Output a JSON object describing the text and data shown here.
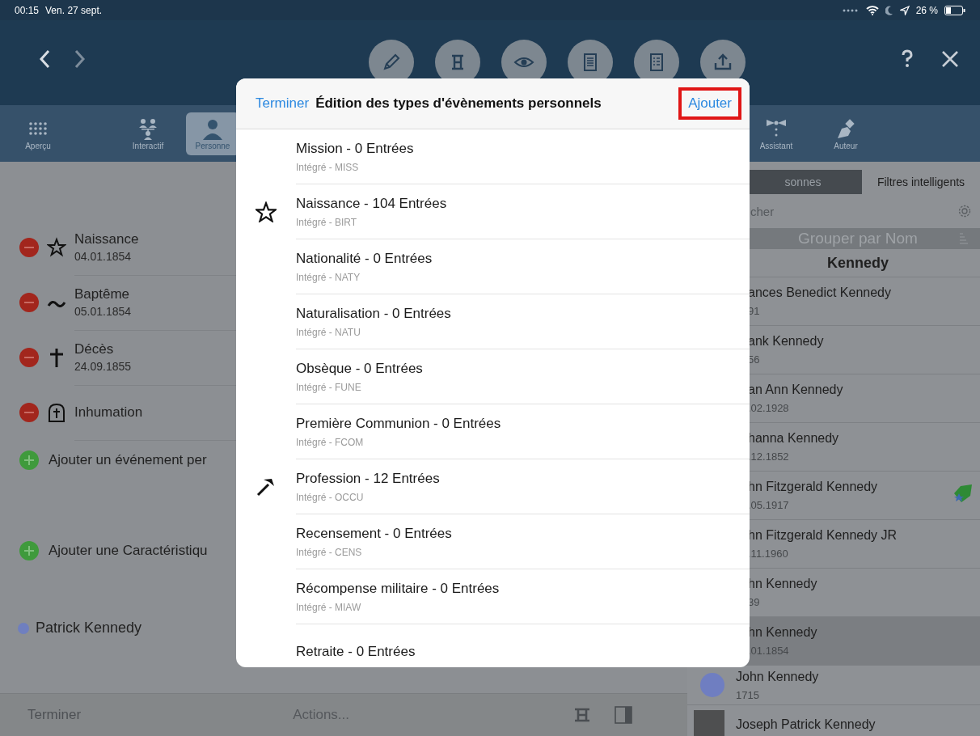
{
  "status_bar": {
    "time": "00:15",
    "date": "Ven. 27 sept.",
    "battery": "26 %"
  },
  "tab_bar": {
    "left": [
      {
        "label": "Aperçu",
        "selected": false
      },
      {
        "label": "Interactif",
        "selected": false
      },
      {
        "label": "Personne",
        "selected": true
      }
    ],
    "right": [
      {
        "label": "Assistant",
        "selected": false
      },
      {
        "label": "Auteur",
        "selected": false
      }
    ]
  },
  "events": [
    {
      "kind": "star",
      "title": "Naissance",
      "date": "04.01.1854"
    },
    {
      "kind": "tilde",
      "title": "Baptême",
      "date": "05.01.1854"
    },
    {
      "kind": "cross",
      "title": "Décès",
      "date": "24.09.1855"
    },
    {
      "kind": "tomb",
      "title": "Inhumation"
    }
  ],
  "add_event": "Ajouter un événement per",
  "add_characteristic": "Ajouter une Caractéristiqu",
  "relation": "Patrick Kennedy",
  "bottom_bar": {
    "done": "Terminer",
    "actions": "Actions..."
  },
  "right_panel": {
    "segments": [
      {
        "label": "sonnes",
        "selected": true
      },
      {
        "label": "Filtres intelligents",
        "selected": false
      }
    ],
    "search": {
      "placeholder": "cher"
    },
    "group_bar": "Grouper par Nom",
    "section": "Kennedy",
    "people": [
      {
        "name": "ances Benedict Kennedy",
        "date": "91",
        "selected": false
      },
      {
        "name": "ank Kennedy",
        "date": "56",
        "selected": false
      },
      {
        "name": "an Ann Kennedy",
        "date": ".02.1928",
        "selected": false
      },
      {
        "name": "hanna Kennedy",
        "date": ".12.1852",
        "selected": false
      },
      {
        "name": "hn Fitzgerald Kennedy",
        "date": ".05.1917",
        "selected": false,
        "tagged": true
      },
      {
        "name": "hn Fitzgerald Kennedy JR",
        "date": ".11.1960",
        "selected": false
      },
      {
        "name": "hn Kennedy",
        "date": "39",
        "selected": false
      },
      {
        "name": "hn Kennedy",
        "date": ".01.1854",
        "selected": true
      },
      {
        "name": "John Kennedy",
        "date": "1715",
        "selected": false,
        "kind": "dot"
      },
      {
        "name": "Joseph Patrick Kennedy",
        "selected": false,
        "kind": "photo"
      }
    ]
  },
  "dialog": {
    "done": "Terminer",
    "title": "Édition des types d'évènements personnels",
    "add": "Ajouter",
    "add_highlighted": true,
    "rows": [
      {
        "kind": "plain",
        "title": "Mission - 0 Entrées",
        "subtitle": "Intégré - MISS"
      },
      {
        "kind": "star",
        "title": "Naissance - 104 Entrées",
        "subtitle": "Intégré - BIRT"
      },
      {
        "kind": "plain",
        "title": "Nationalité - 0 Entrées",
        "subtitle": "Intégré - NATY"
      },
      {
        "kind": "plain",
        "title": "Naturalisation - 0 Entrées",
        "subtitle": "Intégré - NATU"
      },
      {
        "kind": "plain",
        "title": "Obsèque - 0 Entrées",
        "subtitle": "Intégré - FUNE"
      },
      {
        "kind": "plain",
        "title": "Première Communion - 0 Entrées",
        "subtitle": "Intégré - FCOM"
      },
      {
        "kind": "hammer",
        "title": "Profession - 12 Entrées",
        "subtitle": "Intégré - OCCU"
      },
      {
        "kind": "plain",
        "title": "Recensement - 0 Entrées",
        "subtitle": "Intégré - CENS"
      },
      {
        "kind": "plain",
        "title": "Récompense militaire - 0 Entrées",
        "subtitle": "Intégré - MIAW"
      },
      {
        "kind": "plain",
        "title": "Retraite - 0 Entrées"
      }
    ]
  }
}
